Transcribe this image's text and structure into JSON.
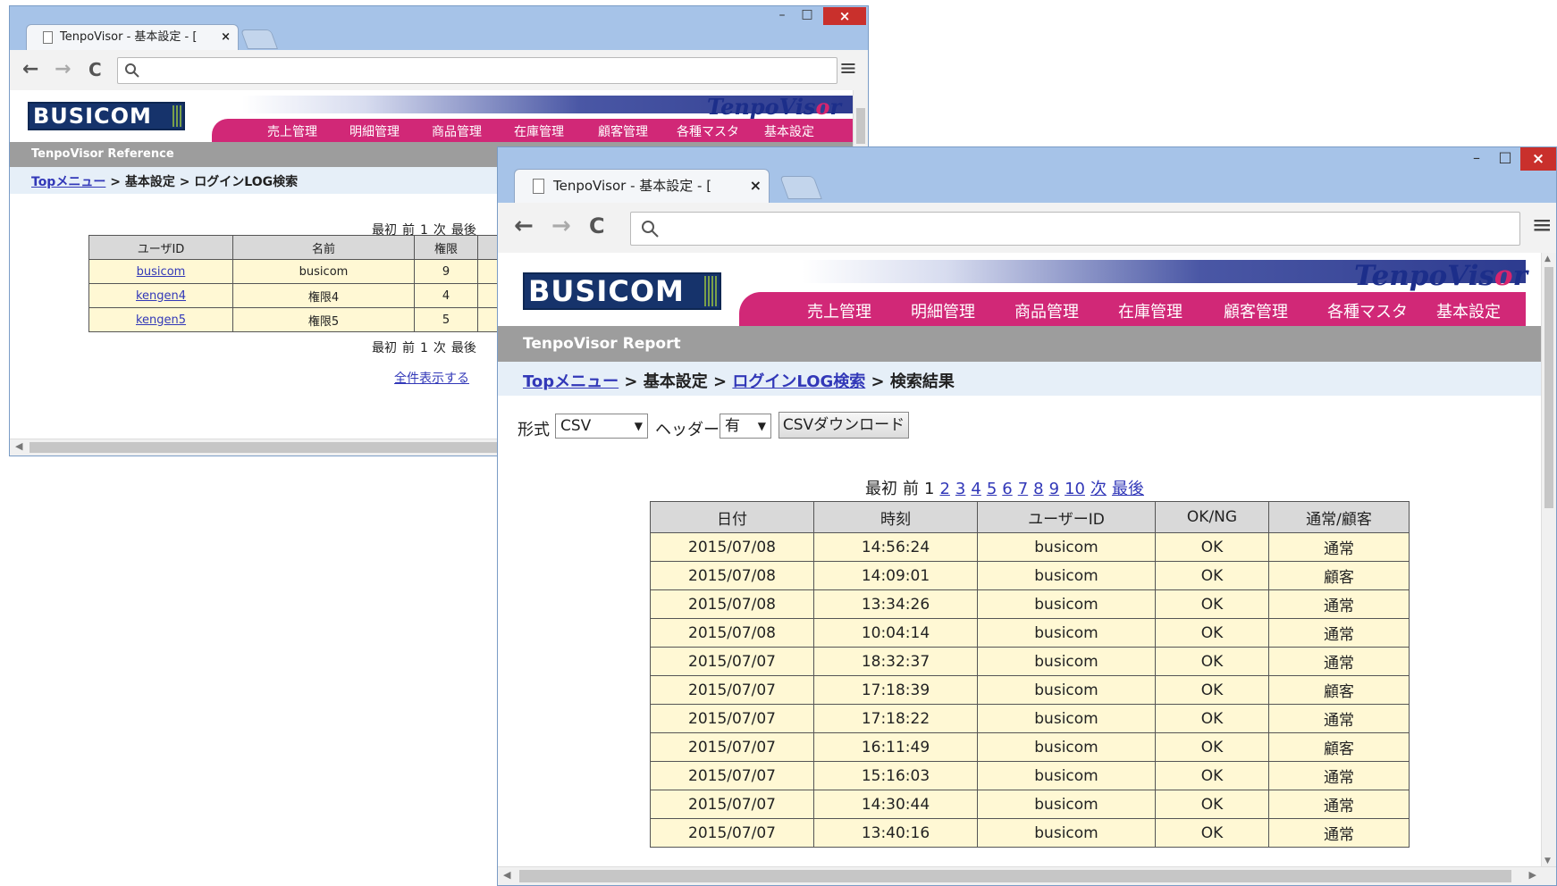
{
  "back_window": {
    "tab_title": "TenpoVisor - 基本設定 - [",
    "logo": "BUSICOM",
    "brand": {
      "a": "TenpoVis",
      "o": "o",
      "b": "r"
    },
    "nav": [
      "売上管理",
      "明細管理",
      "商品管理",
      "在庫管理",
      "顧客管理",
      "各種マスタ",
      "基本設定"
    ],
    "section": "TenpoVisor Reference",
    "breadcrumb": {
      "link": "Topメニュー",
      "rest": " > 基本設定 > ログインLOG検索"
    },
    "pager": {
      "first": "最初",
      "prev": "前",
      "page": "1",
      "next": "次",
      "last": "最後"
    },
    "columns": [
      "ユーザID",
      "名前",
      "権限"
    ],
    "rows": [
      {
        "id": "busicom",
        "name": "busicom",
        "level": "9"
      },
      {
        "id": "kengen4",
        "name": "権限4",
        "level": "4"
      },
      {
        "id": "kengen5",
        "name": "権限5",
        "level": "5"
      }
    ],
    "show_all": "全件表示する"
  },
  "front_window": {
    "tab_title": "TenpoVisor - 基本設定 - [",
    "logo": "BUSICOM",
    "brand": {
      "a": "TenpoVis",
      "o": "o",
      "b": "r"
    },
    "nav": [
      "売上管理",
      "明細管理",
      "商品管理",
      "在庫管理",
      "顧客管理",
      "各種マスタ",
      "基本設定"
    ],
    "section": "TenpoVisor Report",
    "breadcrumb": {
      "link1": "Topメニュー",
      "sep1": " > 基本設定 > ",
      "link2": "ログインLOG検索",
      "rest": " > 検索結果"
    },
    "form": {
      "format_label": "形式",
      "format_value": "CSV",
      "header_label": "ヘッダー",
      "header_value": "有",
      "download": "CSVダウンロード"
    },
    "pager": {
      "first": "最初",
      "prev": "前",
      "current": "1",
      "pages": [
        "2",
        "3",
        "4",
        "5",
        "6",
        "7",
        "8",
        "9",
        "10"
      ],
      "next": "次",
      "last": "最後"
    },
    "columns": [
      "日付",
      "時刻",
      "ユーザーID",
      "OK/NG",
      "通常/顧客"
    ],
    "rows": [
      [
        "2015/07/08",
        "14:56:24",
        "busicom",
        "OK",
        "通常"
      ],
      [
        "2015/07/08",
        "14:09:01",
        "busicom",
        "OK",
        "顧客"
      ],
      [
        "2015/07/08",
        "13:34:26",
        "busicom",
        "OK",
        "通常"
      ],
      [
        "2015/07/08",
        "10:04:14",
        "busicom",
        "OK",
        "通常"
      ],
      [
        "2015/07/07",
        "18:32:37",
        "busicom",
        "OK",
        "通常"
      ],
      [
        "2015/07/07",
        "17:18:39",
        "busicom",
        "OK",
        "顧客"
      ],
      [
        "2015/07/07",
        "17:18:22",
        "busicom",
        "OK",
        "通常"
      ],
      [
        "2015/07/07",
        "16:11:49",
        "busicom",
        "OK",
        "顧客"
      ],
      [
        "2015/07/07",
        "15:16:03",
        "busicom",
        "OK",
        "通常"
      ],
      [
        "2015/07/07",
        "14:30:44",
        "busicom",
        "OK",
        "通常"
      ],
      [
        "2015/07/07",
        "13:40:16",
        "busicom",
        "OK",
        "通常"
      ]
    ]
  },
  "icons": {
    "back": "←",
    "forward": "→",
    "reload": "C",
    "search": "search-icon",
    "menu": "≡",
    "close": "×",
    "minimize": "–",
    "maximize": "□"
  },
  "colors": {
    "nav_pink": "#d12877",
    "header_navy": "#2d3b8f",
    "frame_blue": "#a6c3e8",
    "cell_yellow": "#fff8d4",
    "link": "#3238b8"
  }
}
